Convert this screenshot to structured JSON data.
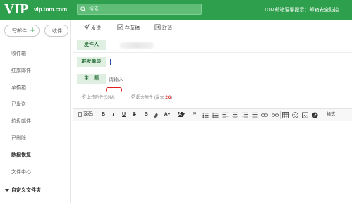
{
  "header": {
    "logo": "VIP",
    "domain": "vip.tom.com",
    "search_placeholder": "搜索",
    "user_greeting": "TOM邮箱温馨提示：邮箱安全防控"
  },
  "sidebar": {
    "compose_label": "写邮件",
    "inbox_button_label": "收件",
    "items": [
      {
        "label": "收件箱"
      },
      {
        "label": "红旗邮件"
      },
      {
        "label": "草稿箱"
      },
      {
        "label": "已发送"
      },
      {
        "label": "垃圾邮件"
      },
      {
        "label": "已删除"
      },
      {
        "label": "数据恢复"
      },
      {
        "label": "文件中心"
      },
      {
        "label": "自定义文件夹"
      }
    ]
  },
  "toolbar": {
    "send_label": "发送",
    "save_draft_label": "存草稿",
    "cancel_label": "取消"
  },
  "form": {
    "sender_label": "发件人",
    "group_label": "群发单显",
    "subject_label": "主　题",
    "subject_placeholder": "请输入"
  },
  "attachments": {
    "upload_label": "上传附件",
    "upload_limit": "(50M)",
    "large_label": "超大附件",
    "large_limit_prefix": "(最大",
    "large_limit_value": "2G",
    "large_limit_suffix": ")"
  },
  "editor_toolbar": {
    "source_label": "源码",
    "bold": "B",
    "italic": "I",
    "underline": "U",
    "strike": "S",
    "clear_format": "S",
    "font_color": "A",
    "bg_color": "A",
    "quote": "❞",
    "format_label": "格式"
  },
  "colors": {
    "header_bg": "#2e9f4c",
    "label_bg": "#dff0e2",
    "highlight_red": "#e02020"
  }
}
